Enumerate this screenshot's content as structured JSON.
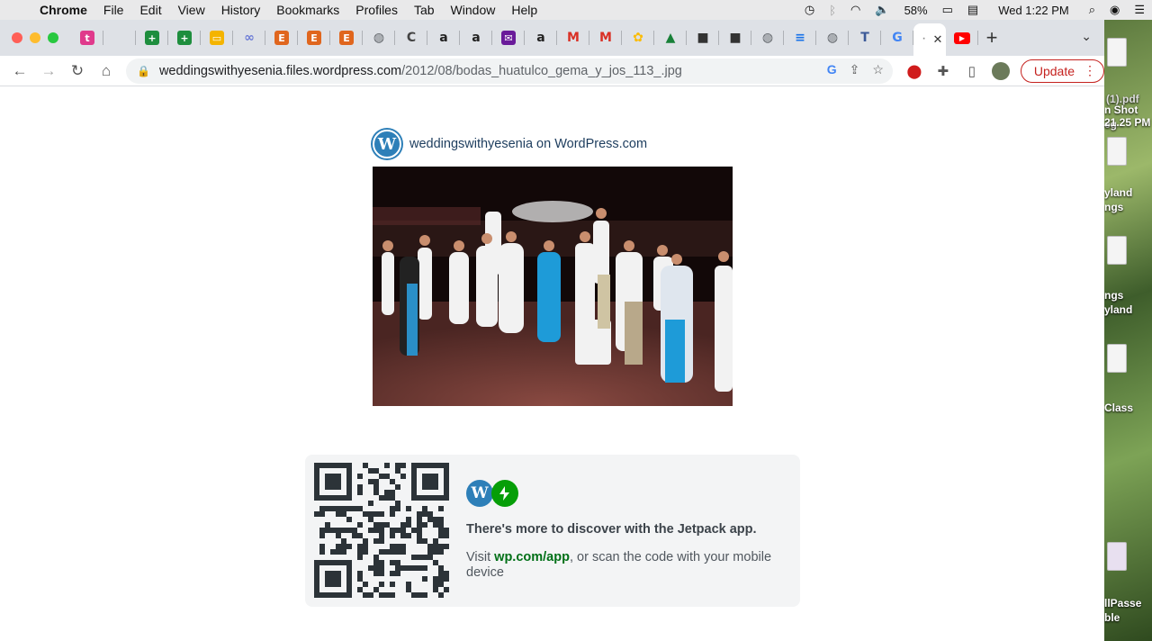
{
  "menubar": {
    "apple": "",
    "app": "Chrome",
    "items": [
      "File",
      "Edit",
      "View",
      "History",
      "Bookmarks",
      "Profiles",
      "Tab",
      "Window",
      "Help"
    ],
    "battery": "58%",
    "datetime": "Wed 1:22 PM"
  },
  "desktop": {
    "labels": [
      "(1).pdf",
      "n Shot eg",
      "21.25 PM",
      "yland",
      "ngs",
      "ngs",
      "yland",
      "Class",
      "llPasse",
      "ble"
    ]
  },
  "tabs": {
    "favicons": [
      {
        "name": "tiktok-icon",
        "glyph": "t",
        "color": "#e03a8c"
      },
      {
        "name": "blank-tab-icon",
        "glyph": "",
        "color": "#dee1e6"
      },
      {
        "name": "sheets-icon",
        "glyph": "+",
        "color": "#1e8e3e"
      },
      {
        "name": "sheets-icon",
        "glyph": "+",
        "color": "#1e8e3e"
      },
      {
        "name": "slides-icon",
        "glyph": "▭",
        "color": "#f4b400"
      },
      {
        "name": "loop-icon",
        "glyph": "∞",
        "color": "#6b7bd6"
      },
      {
        "name": "etsy-icon",
        "glyph": "E",
        "color": "#e0661e"
      },
      {
        "name": "etsy-icon",
        "glyph": "E",
        "color": "#e0661e"
      },
      {
        "name": "etsy-icon",
        "glyph": "E",
        "color": "#e0661e"
      },
      {
        "name": "globe-icon",
        "glyph": "◍",
        "color": "#5f6368"
      },
      {
        "name": "c-icon",
        "glyph": "C",
        "color": "#444"
      },
      {
        "name": "amazon-icon",
        "glyph": "a",
        "color": "#222"
      },
      {
        "name": "amazon-icon",
        "glyph": "a",
        "color": "#222"
      },
      {
        "name": "mail-icon",
        "glyph": "✉",
        "color": "#6a1b9a"
      },
      {
        "name": "amazon-icon",
        "glyph": "a",
        "color": "#222"
      },
      {
        "name": "gmail-icon",
        "glyph": "M",
        "color": "#d93025"
      },
      {
        "name": "gmail-icon",
        "glyph": "M",
        "color": "#d93025"
      },
      {
        "name": "photos-icon",
        "glyph": "✿",
        "color": "#fbbc04"
      },
      {
        "name": "drive-icon",
        "glyph": "▲",
        "color": "#188038"
      },
      {
        "name": "cube-icon",
        "glyph": "■",
        "color": "#333"
      },
      {
        "name": "cube-icon",
        "glyph": "■",
        "color": "#333"
      },
      {
        "name": "globe-icon",
        "glyph": "◍",
        "color": "#5f6368"
      },
      {
        "name": "docs-icon",
        "glyph": "≡",
        "color": "#1a73e8"
      },
      {
        "name": "globe-icon",
        "glyph": "◍",
        "color": "#5f6368"
      },
      {
        "name": "ts-icon",
        "glyph": "T",
        "color": "#3b5998"
      },
      {
        "name": "google-icon",
        "glyph": "G",
        "color": "#4285f4"
      }
    ],
    "active_close": "✕",
    "youtube": "▶",
    "new_tab": "+",
    "tab_menu": "⌄"
  },
  "toolbar": {
    "url_host": "weddingswithyesenia.files.wordpress.com",
    "url_path": "/2012/08/bodas_huatulco_gema_y_jos_113_.jpg",
    "update_label": "Update"
  },
  "page": {
    "site_name": "weddingswithyesenia on WordPress.com",
    "jetpack_heading": "There's more to discover with the Jetpack app.",
    "jetpack_text_before": "Visit ",
    "jetpack_link": "wp.com/app",
    "jetpack_text_after": ", or scan the code with your mobile device"
  },
  "colors": {
    "wp_blue": "#2d7fb8",
    "jetpack_green": "#069e08",
    "update_red": "#c5221f"
  }
}
